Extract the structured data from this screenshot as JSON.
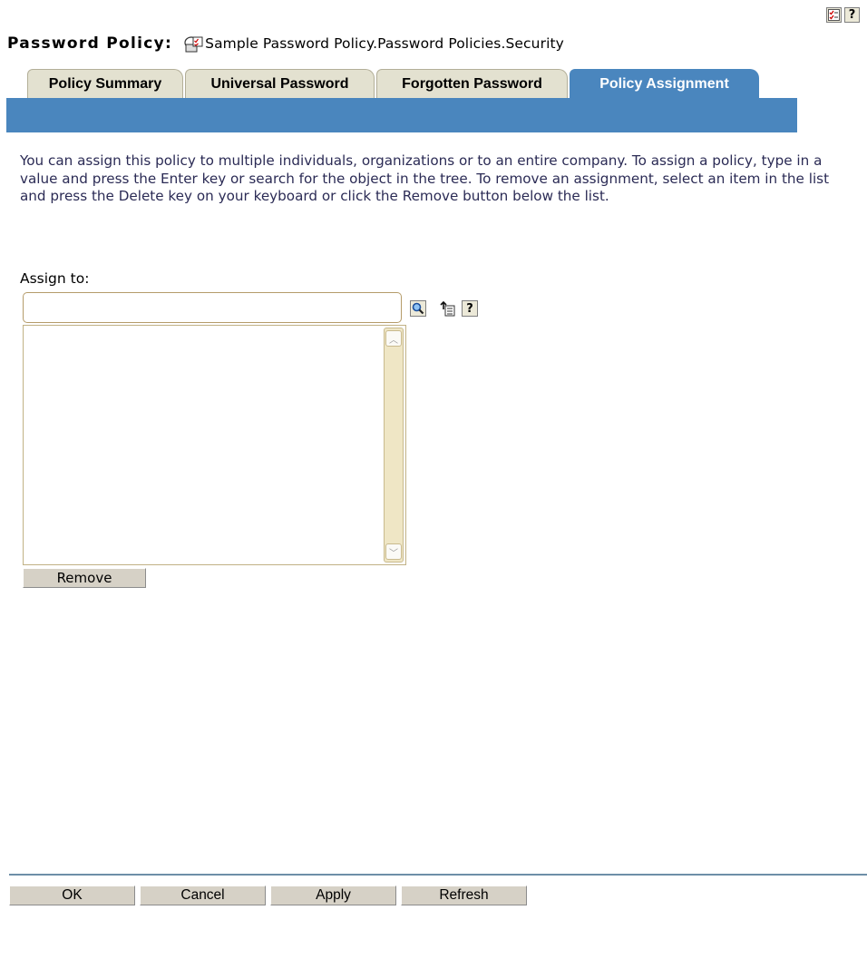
{
  "topbar": {
    "options_icon": "options-checklist-icon",
    "help_icon": "help-icon",
    "help_glyph": "?"
  },
  "header": {
    "label": "Password Policy:",
    "object_icon": "password-policy-object-icon",
    "object_name": "Sample Password Policy.Password Policies.Security"
  },
  "tabs": [
    {
      "label": "Policy Summary",
      "active": false
    },
    {
      "label": "Universal Password",
      "active": false
    },
    {
      "label": "Forgotten Password",
      "active": false
    },
    {
      "label": "Policy Assignment",
      "active": true
    }
  ],
  "description": "You can assign this policy to multiple individuals, organizations or to an entire company.  To assign a policy, type in a value and press the Enter key or search for the object in the tree.  To remove an assignment, select an item in the list and press the Delete key on your keyboard or click the Remove button below the list.",
  "assign": {
    "label": "Assign to:",
    "value": "",
    "search_icon": "magnifier-search-icon",
    "browse_icon": "object-history-icon",
    "help_glyph": "?",
    "items": [],
    "remove_label": "Remove"
  },
  "footer": {
    "ok_label": "OK",
    "cancel_label": "Cancel",
    "apply_label": "Apply",
    "refresh_label": "Refresh"
  },
  "colors": {
    "tab_active": "#4a86be",
    "tab_inactive": "#e3e1d0",
    "description_text": "#2b2b55",
    "button_face": "#d6d1c6"
  }
}
